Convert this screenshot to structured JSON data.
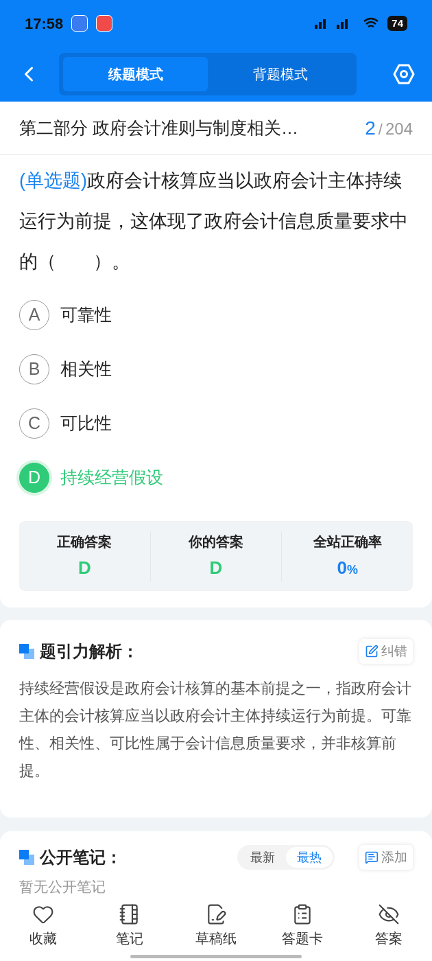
{
  "status_bar": {
    "time": "17:58",
    "battery": "74"
  },
  "mode_tabs": [
    {
      "label": "练题模式",
      "selected": true
    },
    {
      "label": "背题模式",
      "selected": false
    }
  ],
  "section": {
    "title": "第二部分 政府会计准则与制度相关…",
    "current": "2",
    "separator": "/",
    "total": "204"
  },
  "question": {
    "type": "(单选题)",
    "text": "政府会计核算应当以政府会计主体持续运行为前提，这体现了政府会计信息质量要求中的（　　）。"
  },
  "options": [
    {
      "letter": "A",
      "text": "可靠性",
      "correct": false
    },
    {
      "letter": "B",
      "text": "相关性",
      "correct": false
    },
    {
      "letter": "C",
      "text": "可比性",
      "correct": false
    },
    {
      "letter": "D",
      "text": "持续经营假设",
      "correct": true
    }
  ],
  "stats": [
    {
      "label": "正确答案",
      "value": "D",
      "kind": "answer"
    },
    {
      "label": "你的答案",
      "value": "D",
      "kind": "answer"
    },
    {
      "label": "全站正确率",
      "value": "0",
      "unit": "%",
      "kind": "rate"
    }
  ],
  "analysis": {
    "title": "题引力解析：",
    "action": "纠错",
    "text": "持续经营假设是政府会计核算的基本前提之一，指政府会计主体的会计核算应当以政府会计主体持续运行为前提。可靠性、相关性、可比性属于会计信息质量要求，并非核算前提。"
  },
  "notes": {
    "title": "公开笔记：",
    "sort_tabs": [
      {
        "label": "最新",
        "selected": false
      },
      {
        "label": "最热",
        "selected": true
      }
    ],
    "action": "添加",
    "empty": "暂无公开笔记"
  },
  "bottom_nav": [
    {
      "label": "收藏",
      "kind": "heart"
    },
    {
      "label": "笔记",
      "kind": "notebook"
    },
    {
      "label": "草稿纸",
      "kind": "draft"
    },
    {
      "label": "答题卡",
      "kind": "clipboard"
    },
    {
      "label": "答案",
      "kind": "eye-off"
    }
  ]
}
